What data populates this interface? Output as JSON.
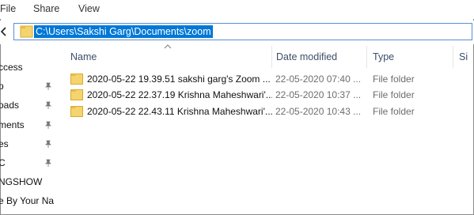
{
  "ribbon": {
    "tabs": [
      {
        "label": "File"
      },
      {
        "label": "Share"
      },
      {
        "label": "View"
      }
    ]
  },
  "address": {
    "path": "C:\\Users\\Sakshi Garg\\Documents\\zoom"
  },
  "nav": {
    "items": [
      {
        "label": "ccess"
      },
      {
        "label": "p"
      },
      {
        "label": "oads"
      },
      {
        "label": "ments"
      },
      {
        "label": "es"
      },
      {
        "label": "C"
      },
      {
        "label": "NGSHOW"
      },
      {
        "label": "e By Your Na"
      }
    ]
  },
  "columns": {
    "name": "Name",
    "date": "Date modified",
    "type": "Type",
    "size": "Si"
  },
  "files": [
    {
      "name": "2020-05-22 19.39.51 sakshi garg's Zoom ...",
      "date": "22-05-2020 07:40 ...",
      "type": "File folder"
    },
    {
      "name": "2020-05-22 22.37.19 Krishna Maheshwari'...",
      "date": "22-05-2020 10:37 ...",
      "type": "File folder"
    },
    {
      "name": "2020-05-22 22.43.11 Krishna Maheshwari'...",
      "date": "22-05-2020 10:43 ...",
      "type": "File folder"
    }
  ],
  "colors": {
    "selection": "#0078d7",
    "folder": "#f0c75e",
    "header_text": "#3c4f6a"
  }
}
